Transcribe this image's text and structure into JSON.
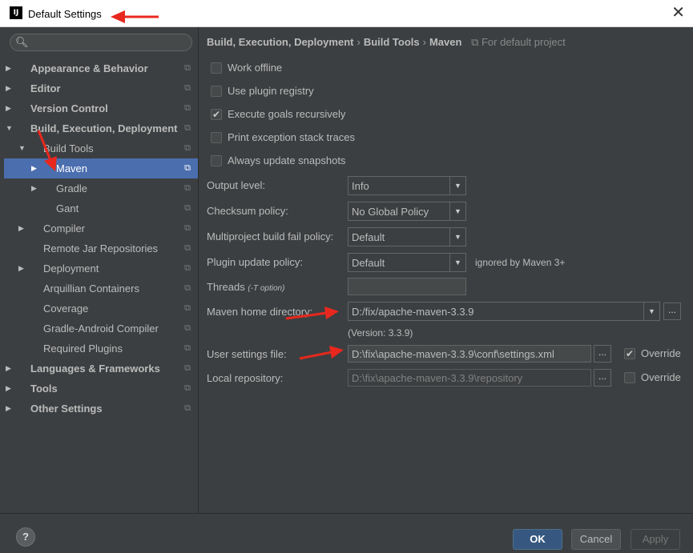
{
  "window": {
    "title": "Default Settings",
    "logo_text": "IJ",
    "close_glyph": "✕"
  },
  "search": {
    "placeholder": "",
    "icon": "search-icon"
  },
  "tree": {
    "items": [
      {
        "label": "Appearance & Behavior",
        "level": 0,
        "expander": "right",
        "bold": true
      },
      {
        "label": "Editor",
        "level": 0,
        "expander": "right",
        "bold": true
      },
      {
        "label": "Version Control",
        "level": 0,
        "expander": "right",
        "bold": true
      },
      {
        "label": "Build, Execution, Deployment",
        "level": 0,
        "expander": "down",
        "bold": true
      },
      {
        "label": "Build Tools",
        "level": 1,
        "expander": "down",
        "bold": false
      },
      {
        "label": "Maven",
        "level": 2,
        "expander": "right",
        "bold": false,
        "selected": true
      },
      {
        "label": "Gradle",
        "level": 2,
        "expander": "right",
        "bold": false
      },
      {
        "label": "Gant",
        "level": 2,
        "expander": "none",
        "bold": false
      },
      {
        "label": "Compiler",
        "level": 1,
        "expander": "right",
        "bold": false
      },
      {
        "label": "Remote Jar Repositories",
        "level": 1,
        "expander": "none",
        "bold": false
      },
      {
        "label": "Deployment",
        "level": 1,
        "expander": "right",
        "bold": false
      },
      {
        "label": "Arquillian Containers",
        "level": 1,
        "expander": "none",
        "bold": false
      },
      {
        "label": "Coverage",
        "level": 1,
        "expander": "none",
        "bold": false
      },
      {
        "label": "Gradle-Android Compiler",
        "level": 1,
        "expander": "none",
        "bold": false
      },
      {
        "label": "Required Plugins",
        "level": 1,
        "expander": "none",
        "bold": false
      },
      {
        "label": "Languages & Frameworks",
        "level": 0,
        "expander": "right",
        "bold": true
      },
      {
        "label": "Tools",
        "level": 0,
        "expander": "right",
        "bold": true
      },
      {
        "label": "Other Settings",
        "level": 0,
        "expander": "right",
        "bold": true
      }
    ]
  },
  "breadcrumb": {
    "part1": "Build, Execution, Deployment",
    "part2": "Build Tools",
    "part3": "Maven",
    "separator": "›",
    "scope": "For default project"
  },
  "options": {
    "work_offline": {
      "label": "Work offline",
      "checked": false
    },
    "use_plugin_registry": {
      "label": "Use plugin registry",
      "checked": false
    },
    "execute_goals": {
      "label": "Execute goals recursively",
      "checked": true
    },
    "print_exception": {
      "label": "Print exception stack traces",
      "checked": false
    },
    "update_snapshots": {
      "label": "Always update snapshots",
      "checked": false
    }
  },
  "fields": {
    "output_level": {
      "label": "Output level:",
      "value": "Info"
    },
    "checksum_policy": {
      "label": "Checksum policy:",
      "value": "No Global Policy"
    },
    "fail_policy": {
      "label": "Multiproject build fail policy:",
      "value": "Default"
    },
    "plugin_update": {
      "label": "Plugin update policy:",
      "value": "Default",
      "hint": "ignored by Maven 3+"
    },
    "threads": {
      "label": "Threads",
      "hint": "(-T option)",
      "value": ""
    },
    "maven_home": {
      "label": "Maven home directory:",
      "value": "D:/fix/apache-maven-3.3.9",
      "version": "(Version: 3.3.9)"
    },
    "user_settings": {
      "label": "User settings file:",
      "value": "D:\\fix\\apache-maven-3.3.9\\conf\\settings.xml",
      "override_label": "Override",
      "override_checked": true
    },
    "local_repo": {
      "label": "Local repository:",
      "value": "D:\\fix\\apache-maven-3.3.9\\repository",
      "override_label": "Override",
      "override_checked": false
    }
  },
  "buttons": {
    "ok": "OK",
    "cancel": "Cancel",
    "apply": "Apply",
    "help": "?",
    "browse": "..."
  },
  "colors": {
    "background": "#3c3f41",
    "selection": "#4b6eaf",
    "annotation_arrow": "#e8281e",
    "ok_button": "#365880"
  }
}
